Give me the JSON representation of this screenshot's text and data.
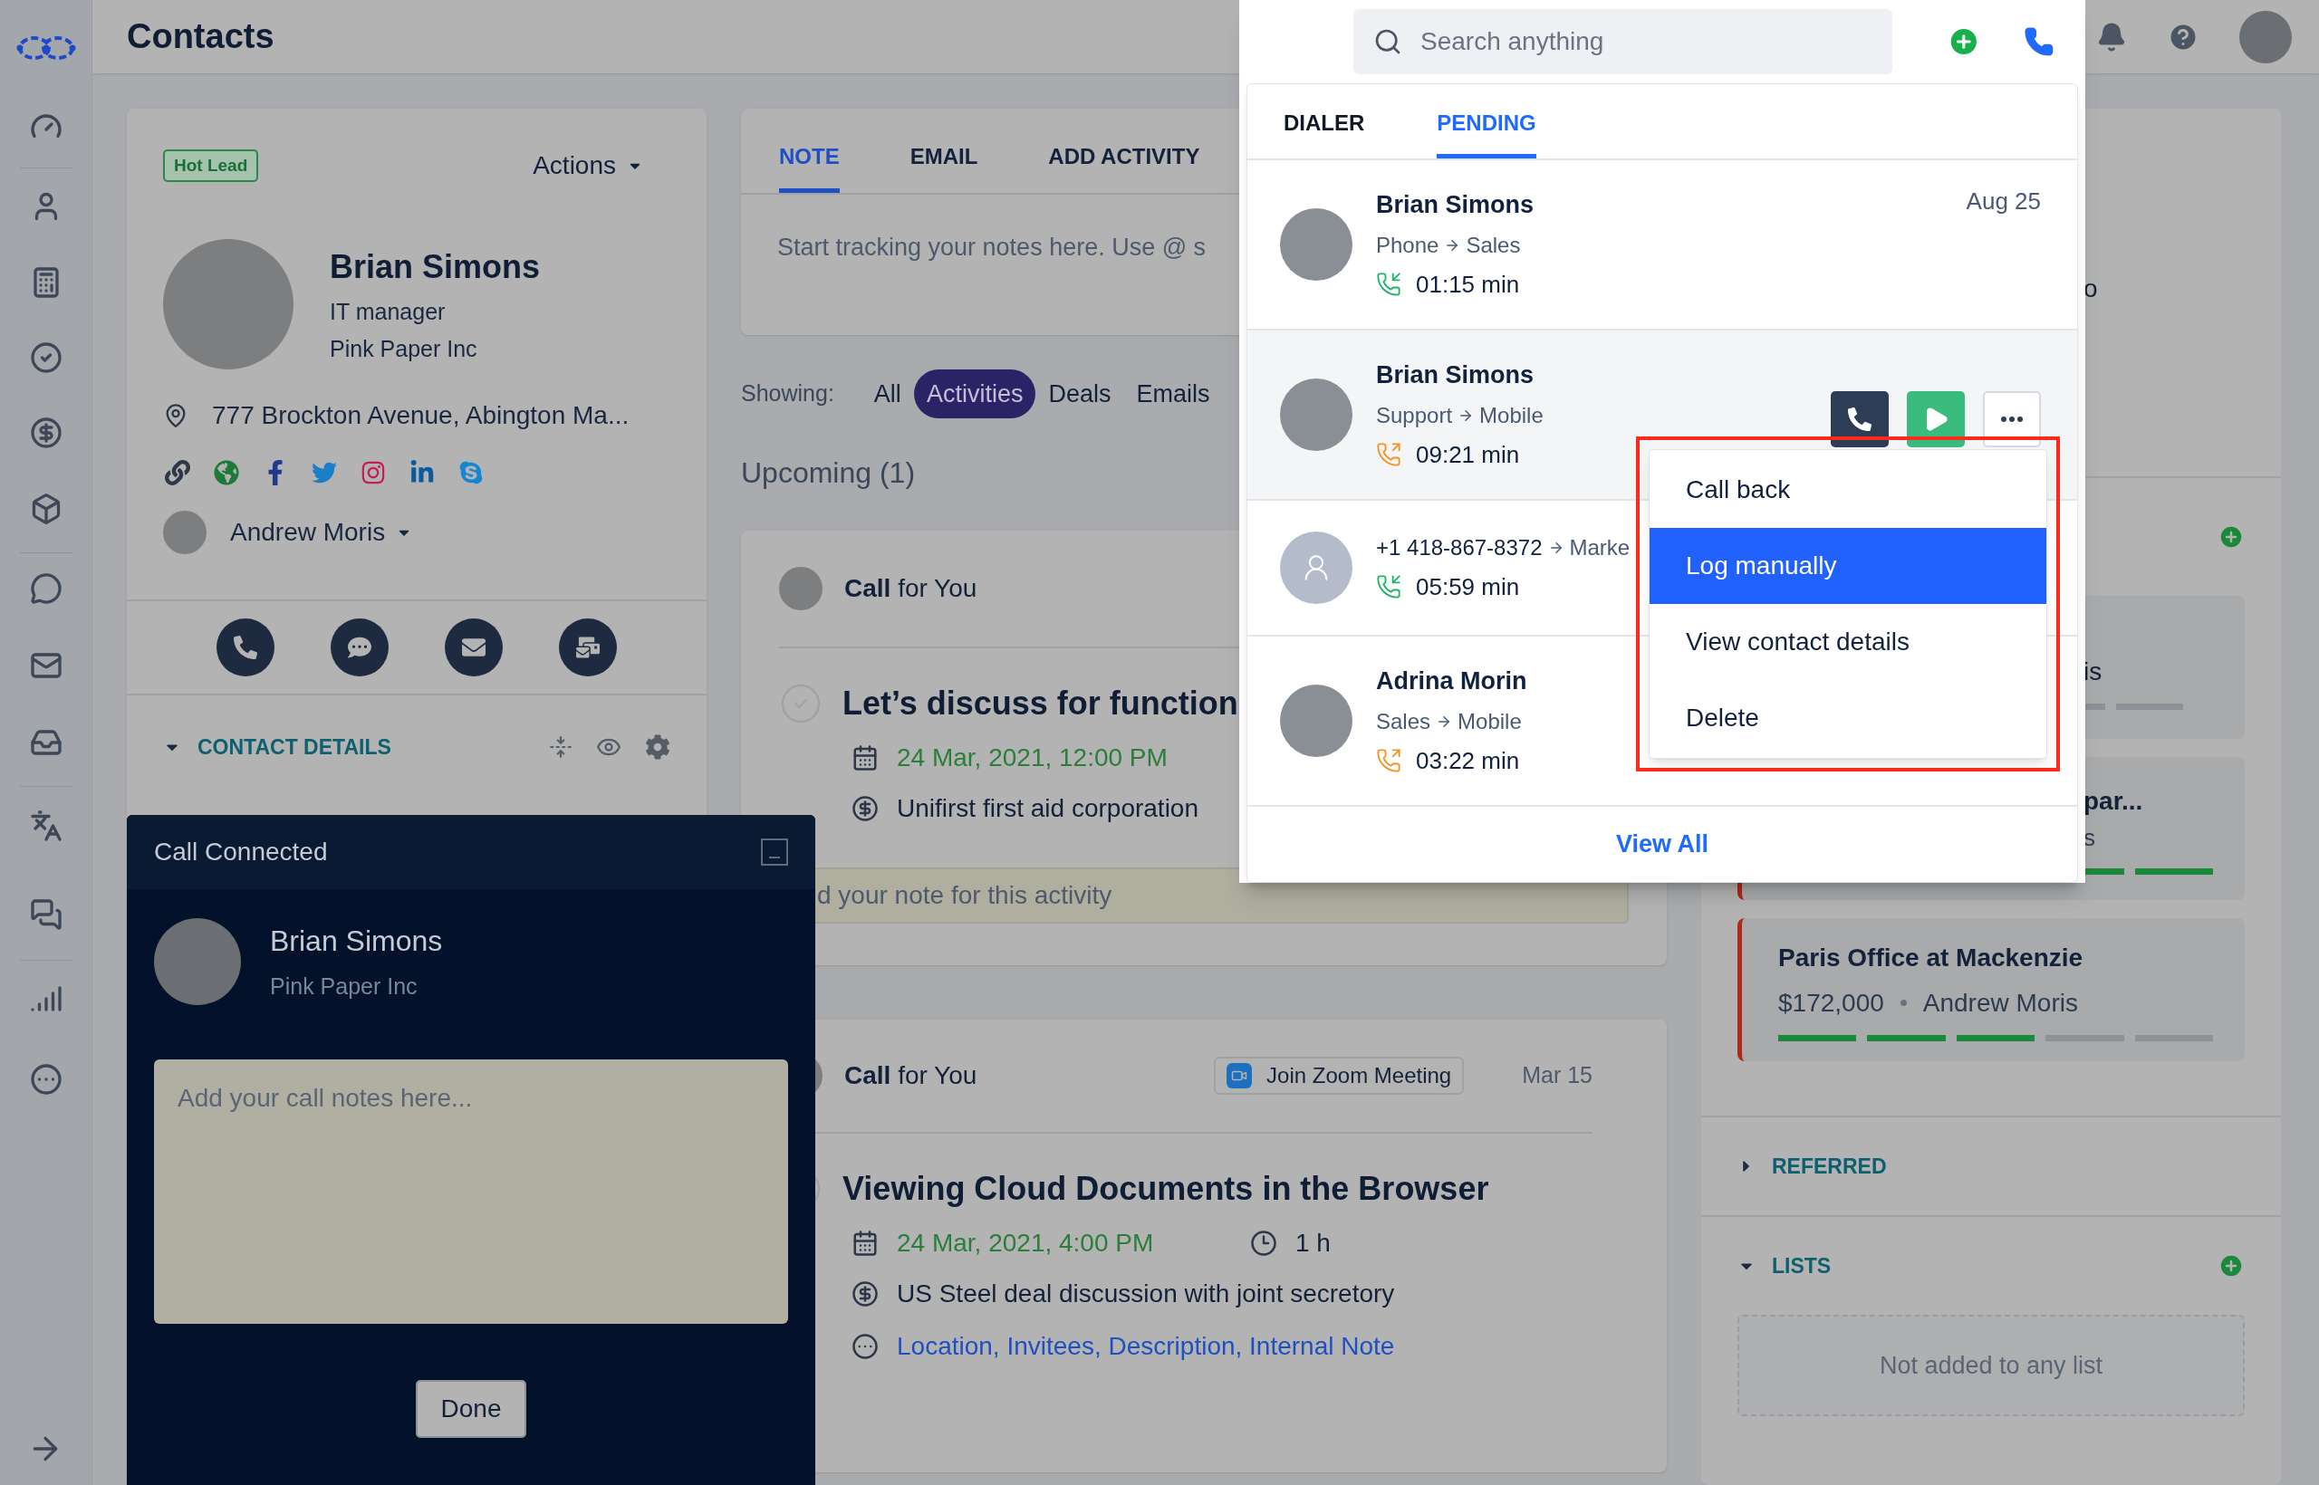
{
  "header": {
    "title": "Contacts",
    "search": {
      "placeholder": "Search anything"
    }
  },
  "contact": {
    "badge": "Hot Lead",
    "actions": "Actions",
    "name": "Brian Simons",
    "job": "IT manager",
    "company": "Pink Paper Inc",
    "address": "777 Brockton Avenue, Abington Ma...",
    "owner": "Andrew Moris",
    "details": {
      "title": "CONTACT DETAILS",
      "expanded": true
    }
  },
  "composer": {
    "tabs": [
      {
        "label": "NOTE",
        "selected": true
      },
      {
        "label": "EMAIL",
        "selected": false
      },
      {
        "label": "ADD ACTIVITY",
        "selected": false
      }
    ],
    "placeholder": "Start tracking your notes here. Use @ s"
  },
  "filter": {
    "label": "Showing:",
    "options": [
      {
        "label": "All",
        "selected": false
      },
      {
        "label": "Activities",
        "selected": true
      },
      {
        "label": "Deals",
        "selected": false
      },
      {
        "label": "Emails",
        "selected": false
      }
    ]
  },
  "upcoming": {
    "title": "Upcoming (1)"
  },
  "activities": [
    {
      "owner": "**Call** for You",
      "title": "Let’s discuss for function",
      "date": "24 Mar, 2021, 12:00 PM",
      "deal": "Unifirst first aid corporation",
      "note_placeholder": "d your note for this activity",
      "done": false
    },
    {
      "owner": "**Call** for You",
      "meeting": "Join Zoom Meeting",
      "when": "Mar 15",
      "title": "Viewing Cloud Documents in the Browser",
      "date": "24 Mar, 2021, 4:00 PM",
      "duration": "1 h",
      "deal": "US Steel deal discussion with joint secretory",
      "more": "Location, Invitees, Description, Internal Note",
      "done": false
    }
  ],
  "right_panel": {
    "fragment": "o",
    "deals": [
      {
        "kind": "covered",
        "title": "is"
      },
      {
        "kind": "partial",
        "title": "par...",
        "subtitle": "s",
        "level": 1,
        "overdue": true
      },
      {
        "kind": "full",
        "title": "Paris Office at Mackenzie",
        "amount": "$172,000",
        "owner": "Andrew Moris",
        "level": 0.6,
        "overdue": true
      }
    ],
    "sections": [
      {
        "title": "REFERRED",
        "expanded": false
      },
      {
        "title": "LISTS",
        "expanded": true,
        "empty": "Not added to any list"
      }
    ]
  },
  "dialer": {
    "tabs": [
      {
        "label": "DIALER",
        "selected": false
      },
      {
        "label": "PENDING",
        "selected": true
      }
    ],
    "calls": [
      {
        "name": "Brian Simons",
        "from": "Phone",
        "to": "Sales",
        "duration": "01:15 min",
        "incoming": true,
        "date": "Aug 25",
        "has_photo": true,
        "hovered": false
      },
      {
        "name": "Brian Simons",
        "from": "Support",
        "to": "Mobile",
        "duration": "09:21 min",
        "incoming": false,
        "has_photo": true,
        "hovered": true
      },
      {
        "from": "+1 418-867-8372",
        "to": "Marke",
        "duration": "05:59 min",
        "incoming": true,
        "has_photo": false,
        "hovered": false
      },
      {
        "name": "Adrina Morin",
        "from": "Sales",
        "to": "Mobile",
        "duration": "03:22 min",
        "incoming": false,
        "has_photo": true,
        "hovered": false
      }
    ],
    "view_all": "View All"
  },
  "menu": {
    "highlighted": true,
    "items": [
      {
        "label": "Call back",
        "selected": false
      },
      {
        "label": "Log manually",
        "selected": true
      },
      {
        "label": "View contact details",
        "selected": false
      },
      {
        "label": "Delete",
        "selected": false
      }
    ]
  },
  "call_panel": {
    "title": "Call Connected",
    "name": "Brian Simons",
    "company": "Pink Paper Inc",
    "placeholder": "Add your call notes here...",
    "button": "Done"
  }
}
